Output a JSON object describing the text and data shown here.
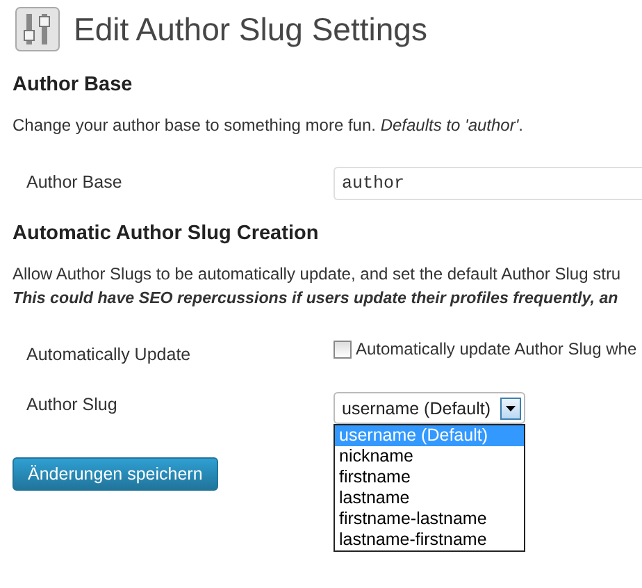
{
  "page_title": "Edit Author Slug Settings",
  "sections": [
    {
      "heading": "Author Base",
      "description": [
        {
          "text": "Change your author base to something more fun. *Defaults to 'author'*.",
          "emphasis": false
        }
      ],
      "fields": [
        {
          "kind": "text",
          "label": "Author Base",
          "value": "author"
        }
      ]
    },
    {
      "heading": "Automatic Author Slug Creation",
      "description": [
        {
          "text": "Allow Author Slugs to be automatically update, and set the default Author Slug stru",
          "emphasis": false
        },
        {
          "text": "This could have SEO repercussions if users update their profiles frequently, an",
          "emphasis": true
        }
      ],
      "fields": [
        {
          "kind": "checkbox",
          "label": "Automatically Update",
          "checked": false,
          "text": "Automatically update Author Slug whe"
        },
        {
          "kind": "select",
          "label": "Author Slug",
          "value": "username (Default)",
          "expanded": true,
          "options": [
            {
              "label": "username (Default)",
              "selected": true
            },
            {
              "label": "nickname",
              "selected": false
            },
            {
              "label": "firstname",
              "selected": false
            },
            {
              "label": "lastname",
              "selected": false
            },
            {
              "label": "firstname-lastname",
              "selected": false
            },
            {
              "label": "lastname-firstname",
              "selected": false
            }
          ]
        }
      ]
    }
  ],
  "save_button": "Änderungen speichern"
}
